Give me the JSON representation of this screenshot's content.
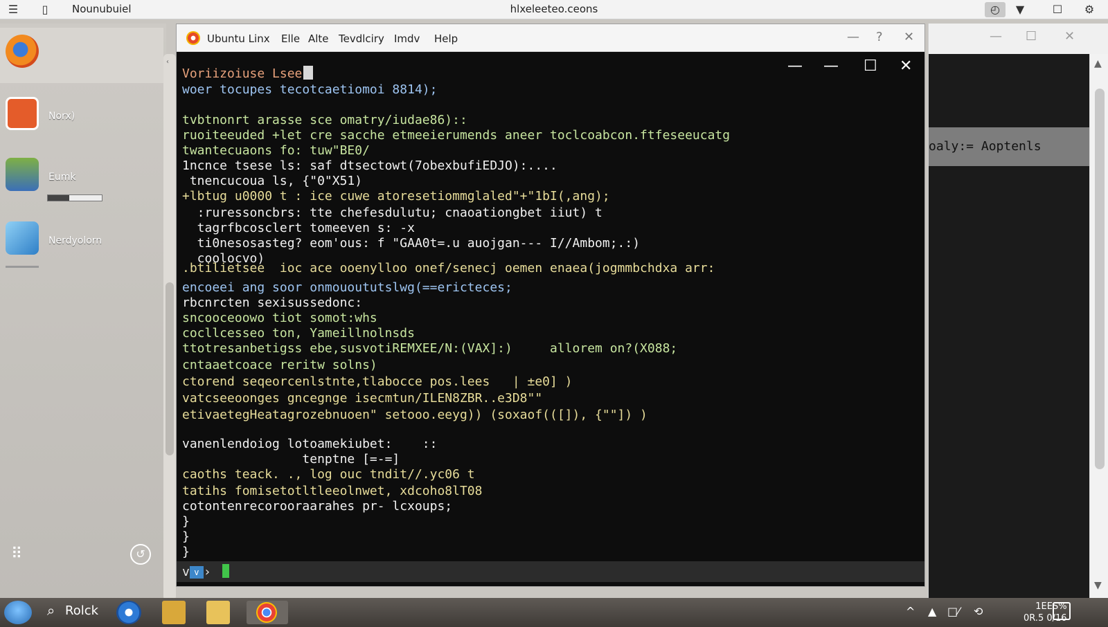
{
  "topbar": {
    "app_title": "Nounubuiel",
    "center_title": "hlxeleeteo.ceons"
  },
  "sidebar": {
    "items": [
      {
        "label": ""
      },
      {
        "label": "Norx)"
      },
      {
        "label": "Eumk"
      },
      {
        "label": "Nerdyolorn"
      }
    ]
  },
  "terminal": {
    "title": "Ubuntu Linx",
    "menu": [
      "Elle",
      "Alte",
      "Tevdlciry",
      "Imdv",
      "Help"
    ],
    "lines": [
      {
        "text": "Voriizoiuse Lsee",
        "color": "orange",
        "cursor": true
      },
      {
        "text": "woer tocupes tecotcaetiomoi 8814);",
        "color": "blue"
      },
      {
        "text": "",
        "color": "white"
      },
      {
        "text": "tvbtnonrt arasse sce omatry/iudae86)::",
        "color": "green"
      },
      {
        "text": "ruoiteeuded +let cre sacche etmeeierumends aneer toclcoabcon.ftfeseeucatg",
        "color": "green"
      },
      {
        "text": "twantecuaons fo: tuw\"BE0/",
        "color": "green"
      },
      {
        "text": "1ncnce tsese ls: saf dtsectowt(7obexbufiEDJO):....",
        "color": "white"
      },
      {
        "text": " tnencucoua ls, {\"0\"X51)",
        "color": "white"
      },
      {
        "text": "+lbtug u0000 t : ice cuwe atoresetiommglaled\"+\"1bI(,ang);",
        "color": "yellow"
      },
      {
        "text": "  :ruressoncbrs: tte chefesdulutu; cnaoationgbet iiut) t",
        "color": "white"
      },
      {
        "text": "  tagrfbcosclert tomeeven s: -x",
        "color": "white"
      },
      {
        "text": "  ti0nesosasteg? eom'ous: f \"GAA0t=.u auojgan--- I//Ambom;.:)",
        "color": "white"
      },
      {
        "text": "  coolocvo)",
        "color": "white"
      },
      {
        "text": ".btilietsee  ioc ace ooenylloo onef/senecj oemen enaea(jogmmbchdxa arr:",
        "color": "yellow"
      },
      {
        "text": "encoeei ang soor onmouoututslwg(==ericteces;",
        "color": "blue"
      },
      {
        "text": "rbcnrcten sexisussedonc:",
        "color": "white"
      },
      {
        "text": "sncooceoowo tiot somot:whs",
        "color": "green"
      },
      {
        "text": "cocllcesseo ton, Yameillnolnsds",
        "color": "green"
      },
      {
        "text": "ttotresanbetigss ebe,susvotiREMXEE/N:(VAX]:)     allorem on?(X088;",
        "color": "green"
      },
      {
        "text": "cntaaetcoace reritw solns)",
        "color": "green"
      },
      {
        "text": "ctorend seqeorcenlstnte,tlabocce pos.lees   | ±e0] )",
        "color": "yellow"
      },
      {
        "text": "vatcseeoonges gncegnge isecmtun/ILEN8ZBR..e3D8\"\"",
        "color": "yellow"
      },
      {
        "text": "etivaetegHeatagrozebnuoen\" setooo.eeyg)) (soxaof(([]), {\"\"]) )",
        "color": "yellow"
      },
      {
        "text": "",
        "color": "white"
      },
      {
        "text": "vanenlendoiog lotoamekiubet:    ::",
        "color": "white"
      },
      {
        "text": "                tenptne [=-=]",
        "color": "white"
      },
      {
        "text": "caoths teack. ., log ouc tndit//.yc06 t",
        "color": "yellow"
      },
      {
        "text": "tatihs fomisetotltleeolnwet, xdcoho8lT08",
        "color": "yellow"
      },
      {
        "text": "cotontenrecorooraarahes pr- lcxoups;",
        "color": "white"
      },
      {
        "text": "}",
        "color": "white"
      },
      {
        "text": "}",
        "color": "white"
      },
      {
        "text": "}",
        "color": "white"
      }
    ],
    "prompt": {
      "prefix": "v",
      "chip": "v",
      "arrow": "›"
    }
  },
  "bgwindow": {
    "bar_text": "oaly:= Aoptenls"
  },
  "taskbar": {
    "search_label": "Rolck",
    "tray": [
      "^",
      "▲",
      "□⁄",
      "⟲"
    ],
    "clock": {
      "time": "1EES%",
      "date": "0R.5 0/16"
    }
  }
}
